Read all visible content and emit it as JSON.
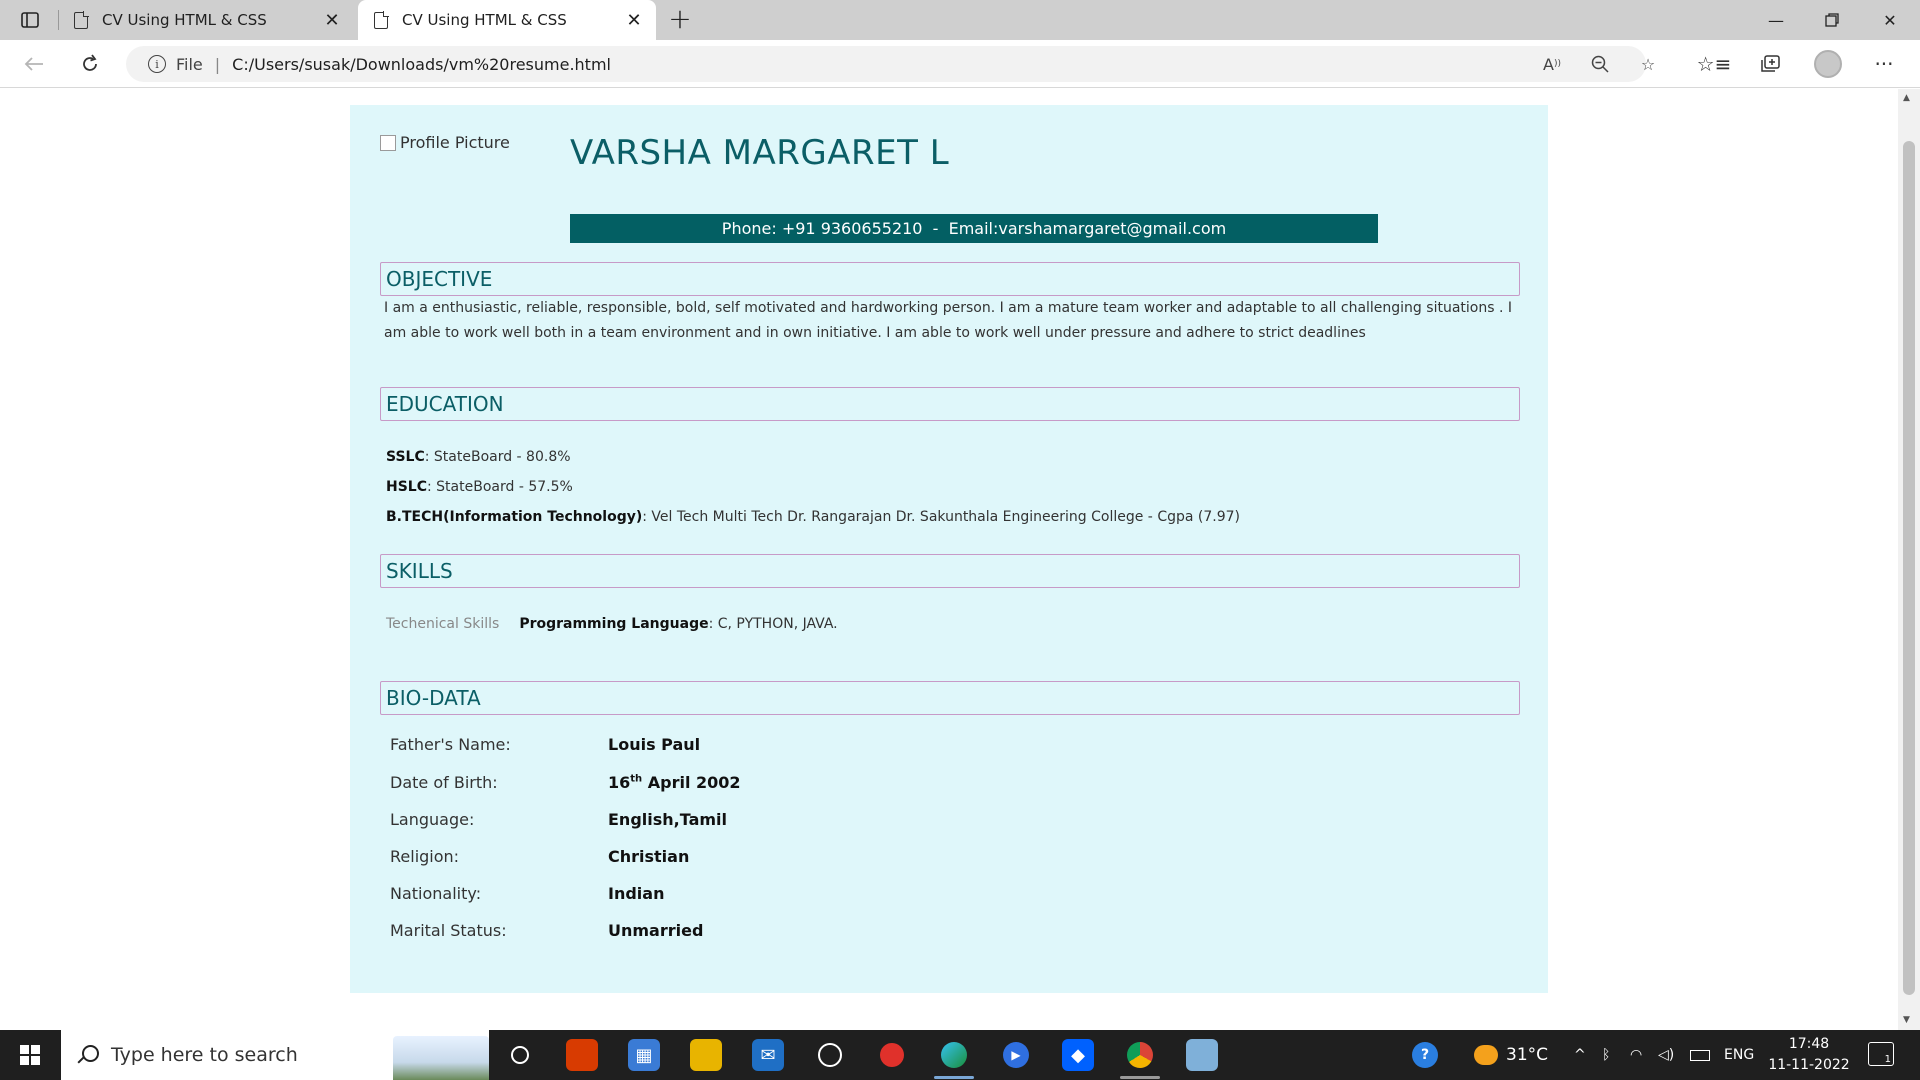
{
  "browser": {
    "tabs": [
      {
        "title": "CV Using HTML & CSS",
        "active": false
      },
      {
        "title": "CV Using HTML & CSS",
        "active": true
      }
    ],
    "address": {
      "scheme_label": "File",
      "url": "C:/Users/susak/Downloads/vm%20resume.html"
    }
  },
  "cv": {
    "profile_alt": "Profile Picture",
    "name": "VARSHA MARGARET L",
    "contact": "Phone: +91 9360655210  -  Email:varshamargaret@gmail.com",
    "objective": {
      "title": "OBJECTIVE",
      "text": "I am a enthusiastic, reliable, responsible, bold, self motivated and hardworking person. I am a mature team worker and adaptable to all challenging situations . I am able to work well both in a team environment and in own initiative. I am able to work well under pressure and adhere to strict deadlines"
    },
    "education": {
      "title": "EDUCATION",
      "items": [
        {
          "degree": "SSLC",
          "detail": ": StateBoard - 80.8%"
        },
        {
          "degree": "HSLC",
          "detail": ": StateBoard - 57.5%"
        },
        {
          "degree": "B.TECH(Information Technology)",
          "detail": ": Vel Tech Multi Tech Dr. Rangarajan Dr. Sakunthala Engineering College - Cgpa (7.97)"
        }
      ]
    },
    "skills": {
      "title": "SKILLS",
      "category": "Techenical Skills",
      "label": "Programming Language",
      "value": ": C, PYTHON, JAVA."
    },
    "biodata": {
      "title": "BIO-DATA",
      "rows": [
        {
          "label": "Father's Name:",
          "value": "Louis Paul"
        },
        {
          "label": "Date of Birth:",
          "day": "16",
          "suffix": "th",
          "rest": " April 2002"
        },
        {
          "label": "Language:",
          "value": "English,Tamil"
        },
        {
          "label": "Religion:",
          "value": "Christian"
        },
        {
          "label": "Nationality:",
          "value": "Indian"
        },
        {
          "label": "Marital Status:",
          "value": "Unmarried"
        }
      ]
    }
  },
  "taskbar": {
    "search_placeholder": "Type here to search",
    "temperature": "31°C",
    "language": "ENG",
    "time": "17:48",
    "date": "11-11-2022",
    "notification_count": "1"
  },
  "colors": {
    "cv_background": "#dff7fa",
    "accent": "#035f63",
    "heading_text": "#0b5e66",
    "section_border": "#c79ac7"
  }
}
